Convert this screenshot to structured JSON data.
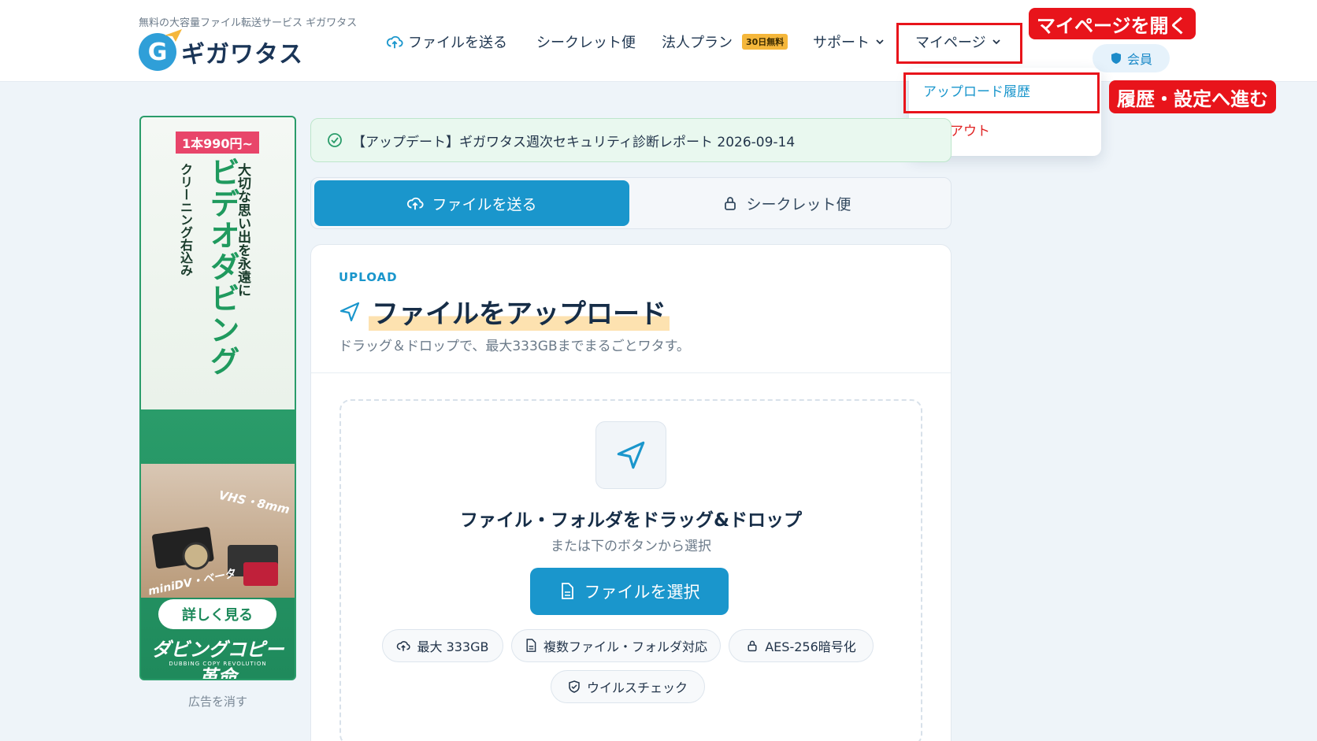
{
  "header": {
    "tagline": "無料の大容量ファイル転送サービス ギガワタス",
    "logo_text": "ギガワタス",
    "logo_mark": "G",
    "nav": {
      "send": "ファイルを送る",
      "secret": "シークレット便",
      "corporate": "法人プラン",
      "corporate_badge": "30日無料",
      "support": "サポート",
      "mypage": "マイページ"
    },
    "member_label": "会員"
  },
  "dropdown": {
    "items": [
      {
        "label": "アップロード履歴",
        "color": "#1a96cc"
      },
      {
        "label": "ログアウト",
        "color": "#e02424"
      }
    ]
  },
  "callouts": {
    "open_mypage": "マイページを開く",
    "go_history": "履歴・設定へ進む"
  },
  "ad": {
    "price": "1本990円~",
    "headline": "大切な思い出を永遠に",
    "title": "ビデオダビング",
    "subtitle": "クリーニング右込み",
    "tag_vhs": "VHS・8mm",
    "tag_minidv": "miniDV・ベータ",
    "button": "詳しく見る",
    "brand": "ダビングコピー革命",
    "brand_sub": "DUBBING COPY REVOLUTION",
    "remove": "広告を消す"
  },
  "notice": {
    "text": "【アップデート】ギガワタス週次セキュリティ診断レポート 2026-09-14"
  },
  "tabs": {
    "send": "ファイルを送る",
    "secret": "シークレット便"
  },
  "card": {
    "label": "UPLOAD",
    "title": "ファイルをアップロード",
    "subtitle": "ドラッグ＆ドロップで、最大333GBまでまるごとワタす。"
  },
  "dropzone": {
    "title": "ファイル・フォルダをドラッグ&ドロップ",
    "subtitle": "または下のボタンから選択",
    "button": "ファイルを選択",
    "chips": {
      "max": "最大 333GB",
      "multi": "複数ファイル・フォルダ対応",
      "aes": "AES-256暗号化",
      "virus": "ウイルスチェック"
    }
  },
  "colors": {
    "accent": "#1a96cc",
    "callout_red": "#e8141b",
    "ad_green": "#2a9c6a"
  }
}
